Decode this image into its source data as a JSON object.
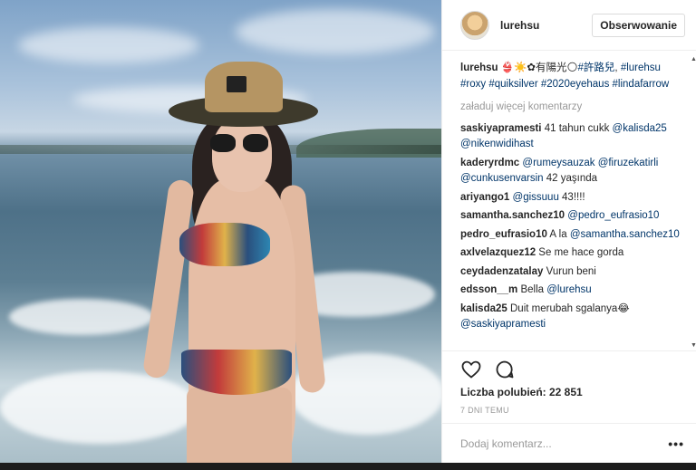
{
  "post": {
    "username": "lurehsu",
    "follow_label": "Obserwowanie",
    "caption": {
      "username": "lurehsu",
      "text": " 👙☀️✿有陽光🌕",
      "tags": [
        "#許路兒",
        "#lurehsu",
        "#roxy",
        "#quiksilver",
        "#2020eyehaus",
        "#lindafarrow"
      ]
    },
    "load_more": "załaduj więcej komentarzy",
    "comments": [
      {
        "user": "saskiyapramesti",
        "text": " 41 tahun cukk ",
        "mentions": [
          "@kalisda25",
          "@nikenwidihast"
        ]
      },
      {
        "user": "kaderyrdmc",
        "text": " ",
        "mentions": [
          "@rumeysauzak",
          "@firuzekatirli",
          "@cunkusenvarsin"
        ],
        "suffix": " 42 yaşında"
      },
      {
        "user": "ariyango1",
        "text": " ",
        "mentions": [
          "@gissuuu"
        ],
        "suffix": " 43!!!!"
      },
      {
        "user": "samantha.sanchez10",
        "text": " ",
        "mentions": [
          "@pedro_eufrasio10"
        ]
      },
      {
        "user": "pedro_eufrasio10",
        "text": " A la ",
        "mentions": [
          "@samantha.sanchez10"
        ]
      },
      {
        "user": "axlvelazquez12",
        "text": " Se me hace gorda",
        "mentions": []
      },
      {
        "user": "ceydadenzatalay",
        "text": " Vurun beni",
        "mentions": []
      },
      {
        "user": "edsson__m",
        "text": " Bella ",
        "mentions": [
          "@lurehsu"
        ]
      },
      {
        "user": "kalisda25",
        "text": " Duit merubah sgalanya😂 ",
        "mentions": [
          "@saskiyapramesti"
        ]
      }
    ],
    "likes_text": "Liczba polubień: 22 851",
    "time_text": "7 DNI TEMU",
    "add_comment_placeholder": "Dodaj komentarz...",
    "more_label": "•••"
  },
  "icons": {
    "like": "heart-icon",
    "comment": "speech-bubble-icon",
    "more": "more-dots-icon"
  },
  "colors": {
    "link": "#003569",
    "muted": "#999999",
    "text": "#262626",
    "border": "#efefef"
  }
}
